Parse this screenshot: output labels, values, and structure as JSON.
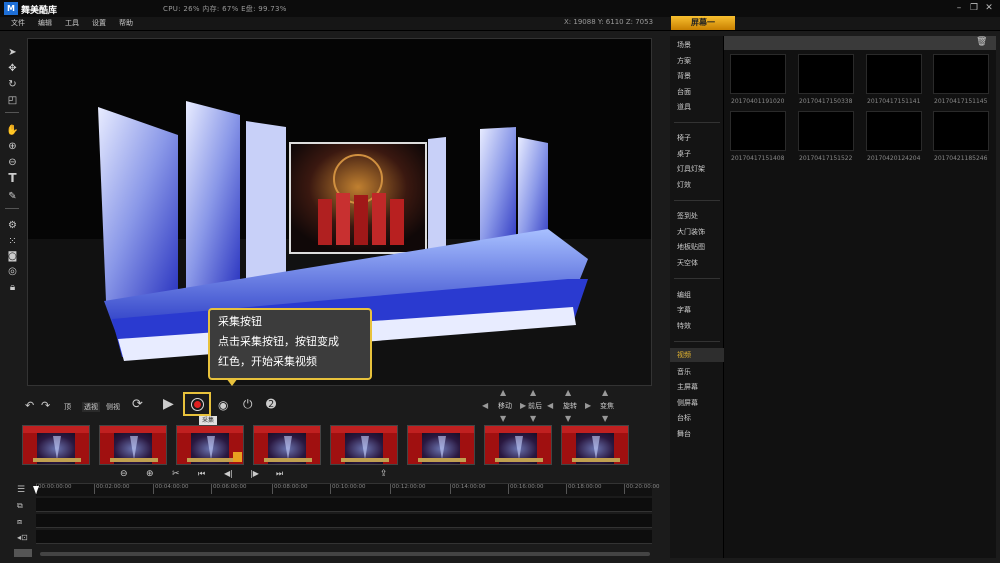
{
  "titlebar": {
    "logo": "M",
    "app_name": "舞美酷库",
    "stats": "CPU: 26%    内存: 67%    E盘: 99.73%",
    "min_icon": "minimize-icon",
    "restore_icon": "restore-icon",
    "close_icon": "close-icon"
  },
  "menu": {
    "items": [
      "文件",
      "编辑",
      "工具",
      "设置",
      "帮助"
    ],
    "coords": "X: 19088  Y: 6110  Z: 7053",
    "screen_button": "屏幕一"
  },
  "callout": {
    "title": "采集按钮",
    "line1": "点击采集按钮，按钮变成",
    "line2": "红色，开始采集视频"
  },
  "controls": {
    "view1": "顶",
    "view2": "透视",
    "view3": "侧视",
    "record_tooltip": "采集"
  },
  "nav_groups": [
    {
      "label": "移动"
    },
    {
      "label": "前后"
    },
    {
      "label": "旋转"
    },
    {
      "label": "变焦"
    }
  ],
  "timeline": {
    "ticks": [
      "00:00:00:00",
      "00:02:00:00",
      "00:04:00:00",
      "00:06:00:00",
      "00:08:00:00",
      "00:10:00:00",
      "00:12:00:00",
      "00:14:00:00",
      "00:16:00:00",
      "00:18:00:00",
      "00:20:00:00"
    ]
  },
  "categories": {
    "group1": [
      "场景",
      "方案",
      "背景",
      "台面",
      "道具"
    ],
    "group2": [
      "椅子",
      "桌子",
      "灯具灯架",
      "灯效"
    ],
    "group3": [
      "签到处",
      "大门装饰",
      "地板贴图",
      "天空体"
    ],
    "group4": [
      "编组",
      "字幕",
      "特效"
    ],
    "group5": [
      "视频",
      "音乐",
      "主屏幕",
      "侧屏幕",
      "台标",
      "舞台"
    ],
    "active": "视频"
  },
  "assets": [
    "20170401191020",
    "20170417150338",
    "20170417151141",
    "20170417151145",
    "20170417151408",
    "20170417151522",
    "20170420124204",
    "20170421185246"
  ],
  "colors": {
    "accent": "#e8c23c",
    "record": "#e02020",
    "stage_blue": "#2a4ad8"
  }
}
